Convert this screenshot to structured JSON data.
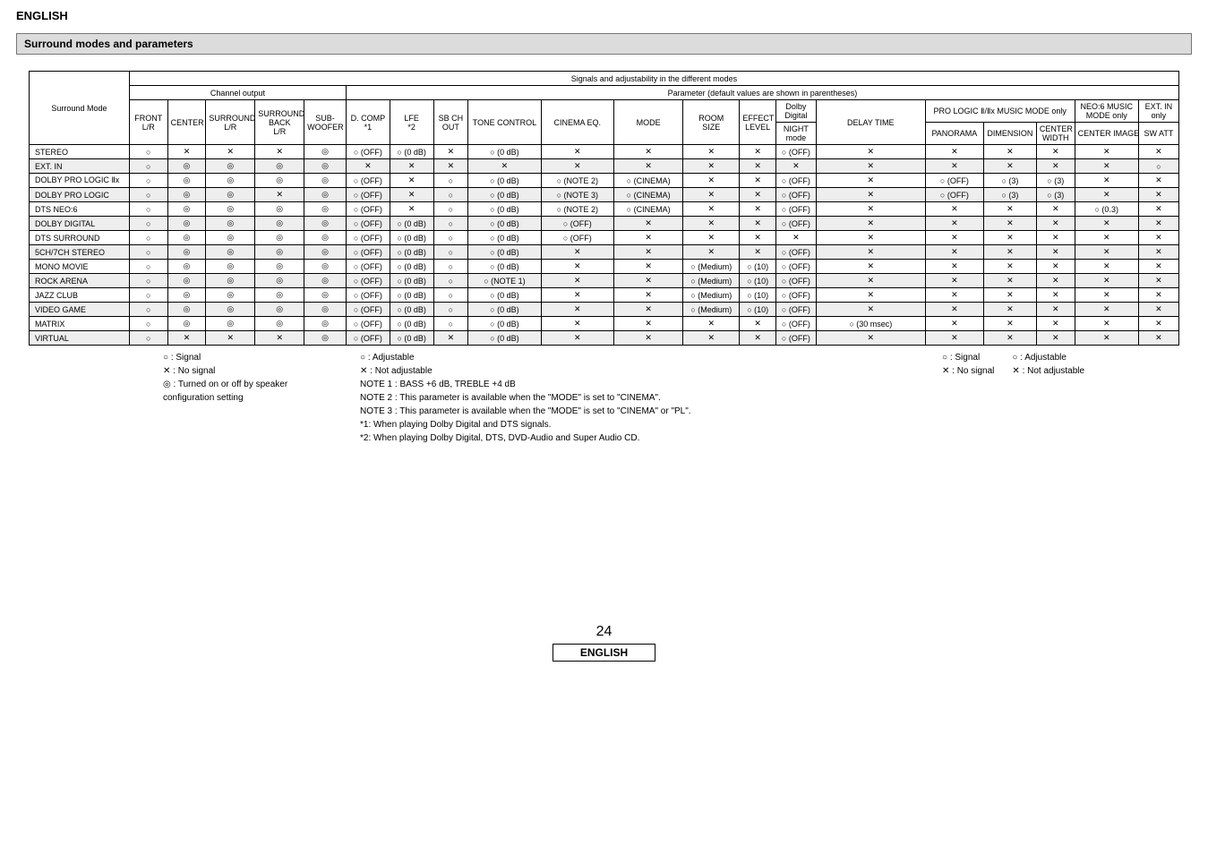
{
  "lang": "ENGLISH",
  "section_title": "Surround modes and parameters",
  "headers": {
    "top_signals": "Signals and adjustability in the different modes",
    "channel_output": "Channel output",
    "parameter_note": "Parameter (default values are shown in parentheses)",
    "surround_mode": "Surround Mode",
    "front": "FRONT\nL/R",
    "center": "CENTER",
    "surround": "SURROUND\nL/R",
    "surround_back": "SURROUND\nBACK\nL/R",
    "sub": "SUB-\nWOOFER",
    "dcomp": "D. COMP\n*1",
    "lfe": "LFE\n*2",
    "sbch": "SB CH\nOUT",
    "tone": "TONE CONTROL",
    "cinema_eq": "CINEMA EQ.",
    "mode": "MODE",
    "room_size": "ROOM\nSIZE",
    "effect": "EFFECT\nLEVEL",
    "dolby_digital": "Dolby\nDigital",
    "night": "NIGHT\nmode",
    "delay": "DELAY TIME",
    "prologic": "PRO LOGIC Ⅱ/Ⅱx MUSIC MODE only",
    "panorama": "PANORAMA",
    "dimension": "DIMENSION",
    "center_width": "CENTER\nWIDTH",
    "neo6": "NEO:6 MUSIC\nMODE only",
    "center_image": "CENTER IMAGE",
    "extin": "EXT. IN\nonly",
    "swatt": "SW ATT"
  },
  "legend": {
    "l1a": "○ :  Signal",
    "l1b": "✕ :  No signal",
    "l1c": "◎ :  Turned on or off by speaker",
    "l1d": "       configuration setting",
    "l2a": "○ :  Adjustable",
    "l2b": "✕ :  Not adjustable",
    "l2c": "NOTE 1 : BASS +6 dB, TREBLE +4 dB",
    "l2d": "NOTE 2 : This parameter is available when the \"MODE\" is set to \"CINEMA\".",
    "l2e": "NOTE 3 : This parameter is available when the \"MODE\" is set to \"CINEMA\" or \"PL\".",
    "l2f": "*1:  When playing Dolby Digital and DTS signals.",
    "l2g": "*2:  When playing Dolby Digital, DTS, DVD-Audio and Super Audio CD.",
    "l3a": "○ :  Signal",
    "l3b": "✕ :  No signal",
    "l4a": "○ :  Adjustable",
    "l4b": "✕ :  Not adjustable"
  },
  "rows": [
    {
      "shade": false,
      "label": "STEREO",
      "c": [
        "○",
        "✕",
        "✕",
        "✕",
        "◎",
        "○ (OFF)",
        "○ (0 dB)",
        "✕",
        "○ (0 dB)",
        "✕",
        "✕",
        "✕",
        "✕",
        "○ (OFF)",
        "✕",
        "✕",
        "✕",
        "✕",
        "✕",
        "✕"
      ]
    },
    {
      "shade": true,
      "label": "EXT. IN",
      "c": [
        "○",
        "◎",
        "◎",
        "◎",
        "◎",
        "✕",
        "✕",
        "✕",
        "✕",
        "✕",
        "✕",
        "✕",
        "✕",
        "✕",
        "✕",
        "✕",
        "✕",
        "✕",
        "✕",
        "○"
      ]
    },
    {
      "shade": false,
      "label": "DOLBY PRO LOGIC Ⅱx",
      "c": [
        "○",
        "◎",
        "◎",
        "◎",
        "◎",
        "○ (OFF)",
        "✕",
        "○",
        "○ (0 dB)",
        "○ (NOTE 2)",
        "○ (CINEMA)",
        "✕",
        "✕",
        "○ (OFF)",
        "✕",
        "○ (OFF)",
        "○ (3)",
        "○ (3)",
        "✕",
        "✕"
      ]
    },
    {
      "shade": true,
      "label": "DOLBY PRO LOGIC",
      "c": [
        "○",
        "◎",
        "◎",
        "✕",
        "◎",
        "○ (OFF)",
        "✕",
        "○",
        "○ (0 dB)",
        "○ (NOTE 3)",
        "○ (CINEMA)",
        "✕",
        "✕",
        "○ (OFF)",
        "✕",
        "○ (OFF)",
        "○ (3)",
        "○ (3)",
        "✕",
        "✕"
      ]
    },
    {
      "shade": false,
      "label": "DTS NEO:6",
      "c": [
        "○",
        "◎",
        "◎",
        "◎",
        "◎",
        "○ (OFF)",
        "✕",
        "○",
        "○ (0 dB)",
        "○ (NOTE 2)",
        "○ (CINEMA)",
        "✕",
        "✕",
        "○ (OFF)",
        "✕",
        "✕",
        "✕",
        "✕",
        "○ (0.3)",
        "✕"
      ]
    },
    {
      "shade": true,
      "label": "DOLBY DIGITAL",
      "c": [
        "○",
        "◎",
        "◎",
        "◎",
        "◎",
        "○ (OFF)",
        "○ (0 dB)",
        "○",
        "○ (0 dB)",
        "○ (OFF)",
        "✕",
        "✕",
        "✕",
        "○ (OFF)",
        "✕",
        "✕",
        "✕",
        "✕",
        "✕",
        "✕"
      ]
    },
    {
      "shade": false,
      "label": "DTS SURROUND",
      "c": [
        "○",
        "◎",
        "◎",
        "◎",
        "◎",
        "○ (OFF)",
        "○ (0 dB)",
        "○",
        "○ (0 dB)",
        "○ (OFF)",
        "✕",
        "✕",
        "✕",
        "✕",
        "✕",
        "✕",
        "✕",
        "✕",
        "✕",
        "✕"
      ]
    },
    {
      "shade": true,
      "label": "5CH/7CH STEREO",
      "c": [
        "○",
        "◎",
        "◎",
        "◎",
        "◎",
        "○ (OFF)",
        "○ (0 dB)",
        "○",
        "○ (0 dB)",
        "✕",
        "✕",
        "✕",
        "✕",
        "○ (OFF)",
        "✕",
        "✕",
        "✕",
        "✕",
        "✕",
        "✕"
      ]
    },
    {
      "shade": false,
      "label": "MONO MOVIE",
      "c": [
        "○",
        "◎",
        "◎",
        "◎",
        "◎",
        "○ (OFF)",
        "○ (0 dB)",
        "○",
        "○ (0 dB)",
        "✕",
        "✕",
        "○ (Medium)",
        "○ (10)",
        "○ (OFF)",
        "✕",
        "✕",
        "✕",
        "✕",
        "✕",
        "✕"
      ]
    },
    {
      "shade": true,
      "label": "ROCK ARENA",
      "c": [
        "○",
        "◎",
        "◎",
        "◎",
        "◎",
        "○ (OFF)",
        "○ (0 dB)",
        "○",
        "○ (NOTE 1)",
        "✕",
        "✕",
        "○ (Medium)",
        "○ (10)",
        "○ (OFF)",
        "✕",
        "✕",
        "✕",
        "✕",
        "✕",
        "✕"
      ]
    },
    {
      "shade": false,
      "label": "JAZZ CLUB",
      "c": [
        "○",
        "◎",
        "◎",
        "◎",
        "◎",
        "○ (OFF)",
        "○ (0 dB)",
        "○",
        "○ (0 dB)",
        "✕",
        "✕",
        "○ (Medium)",
        "○ (10)",
        "○ (OFF)",
        "✕",
        "✕",
        "✕",
        "✕",
        "✕",
        "✕"
      ]
    },
    {
      "shade": true,
      "label": "VIDEO GAME",
      "c": [
        "○",
        "◎",
        "◎",
        "◎",
        "◎",
        "○ (OFF)",
        "○ (0 dB)",
        "○",
        "○ (0 dB)",
        "✕",
        "✕",
        "○ (Medium)",
        "○ (10)",
        "○ (OFF)",
        "✕",
        "✕",
        "✕",
        "✕",
        "✕",
        "✕"
      ]
    },
    {
      "shade": false,
      "label": "MATRIX",
      "c": [
        "○",
        "◎",
        "◎",
        "◎",
        "◎",
        "○ (OFF)",
        "○ (0 dB)",
        "○",
        "○ (0 dB)",
        "✕",
        "✕",
        "✕",
        "✕",
        "○ (OFF)",
        "○ (30 msec)",
        "✕",
        "✕",
        "✕",
        "✕",
        "✕"
      ]
    },
    {
      "shade": true,
      "label": "VIRTUAL",
      "c": [
        "○",
        "✕",
        "✕",
        "✕",
        "◎",
        "○ (OFF)",
        "○ (0 dB)",
        "✕",
        "○ (0 dB)",
        "✕",
        "✕",
        "✕",
        "✕",
        "○ (OFF)",
        "✕",
        "✕",
        "✕",
        "✕",
        "✕",
        "✕"
      ]
    }
  ],
  "page": {
    "num": "24",
    "label": "ENGLISH"
  }
}
